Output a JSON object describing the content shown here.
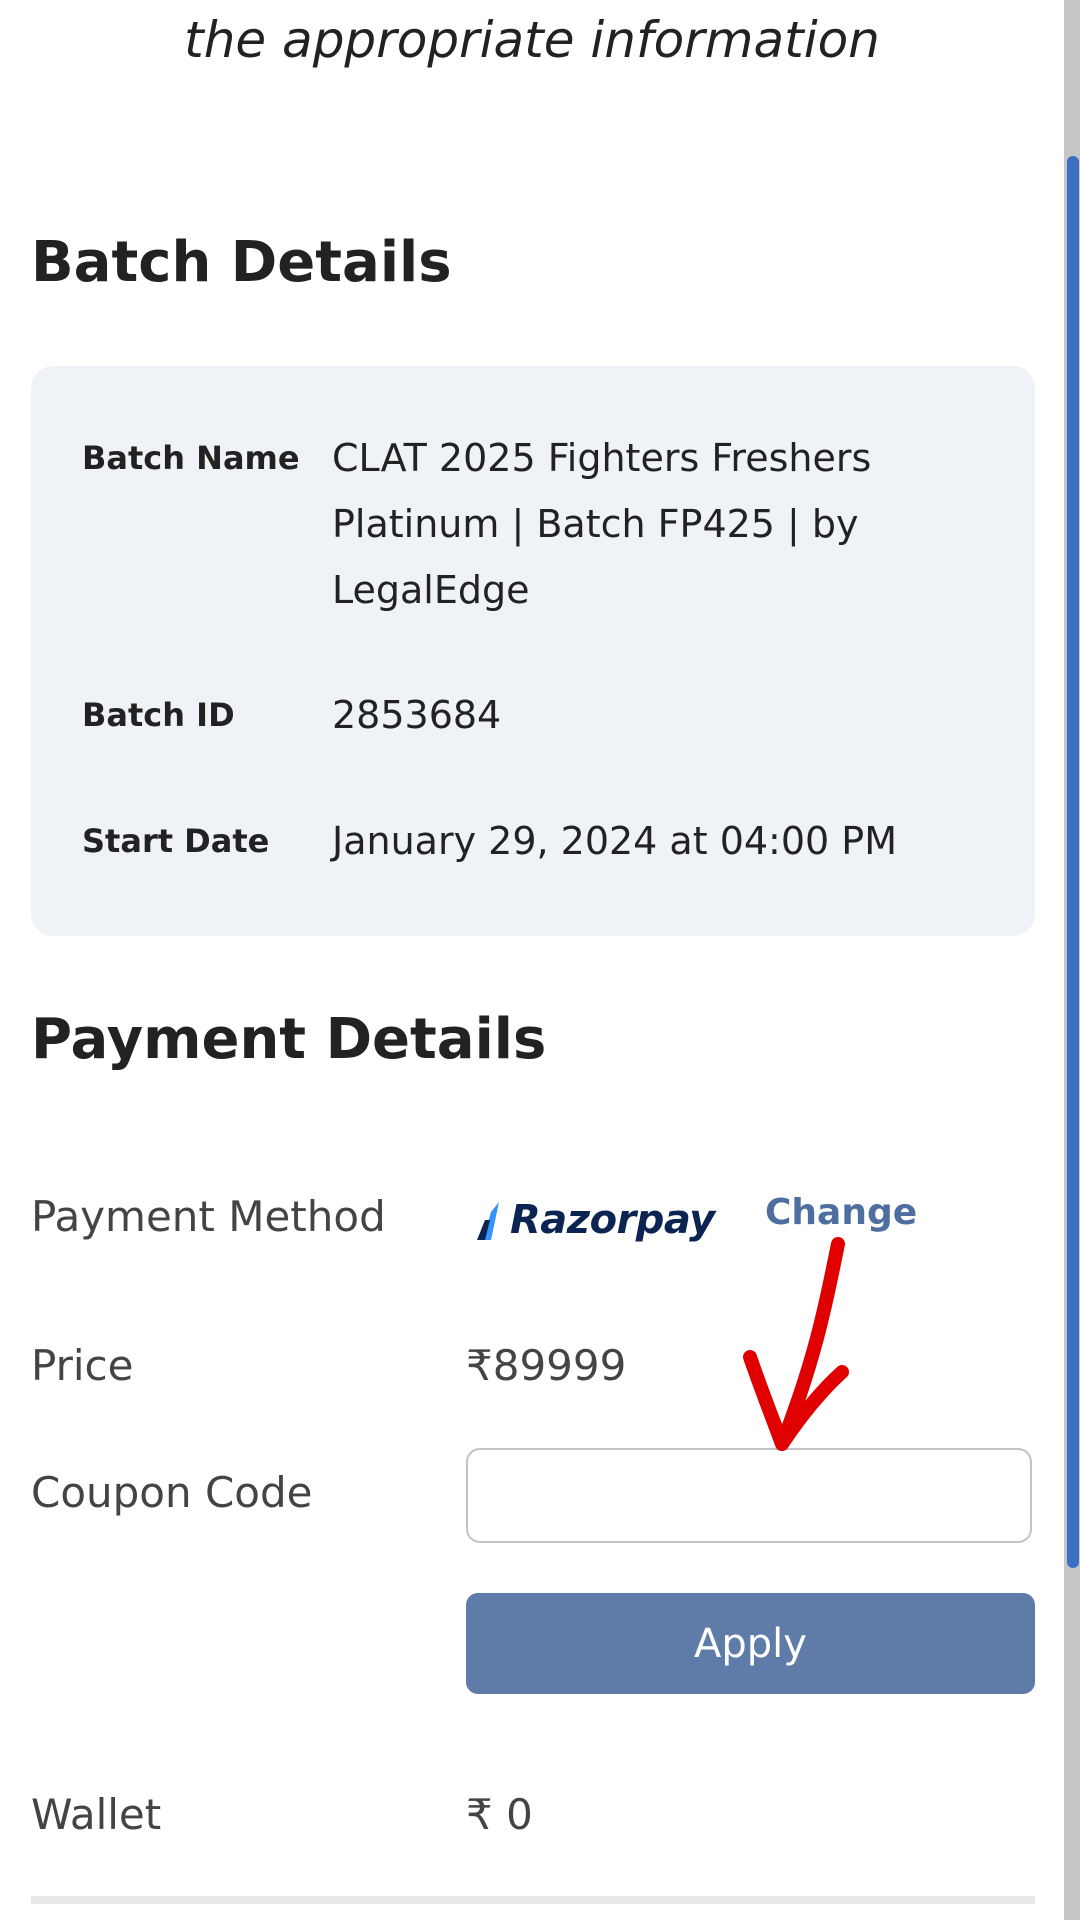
{
  "intro": {
    "text": "the appropriate information"
  },
  "batch_details": {
    "title": "Batch Details",
    "rows": [
      {
        "label": "Batch Name",
        "value": "CLAT 2025 Fighters Freshers Platinum | Batch FP425 | by LegalEdge"
      },
      {
        "label": "Batch ID",
        "value": "2853684"
      },
      {
        "label": "Start Date",
        "value": "January 29, 2024 at 04:00 PM"
      }
    ]
  },
  "payment_details": {
    "title": "Payment Details",
    "method_label": "Payment Method",
    "method_brand": "Razorpay",
    "change_label": "Change",
    "price_label": "Price",
    "price_value": "₹89999",
    "coupon_label": "Coupon Code",
    "coupon_value": "",
    "apply_label": "Apply",
    "wallet_label": "Wallet",
    "wallet_value": "₹ 0"
  },
  "colors": {
    "card_bg": "#eff3f8",
    "apply_bg": "#5f7ca8",
    "link": "#4d6e9e",
    "razorpay_blue": "#3395ff",
    "razorpay_navy": "#0c2451",
    "annotation_arrow": "#e00000",
    "scrollbar_thumb": "#3b6fc4"
  },
  "icons": {
    "brand_logo": "razorpay-logo",
    "annotation": "red-arrow-down-icon"
  }
}
